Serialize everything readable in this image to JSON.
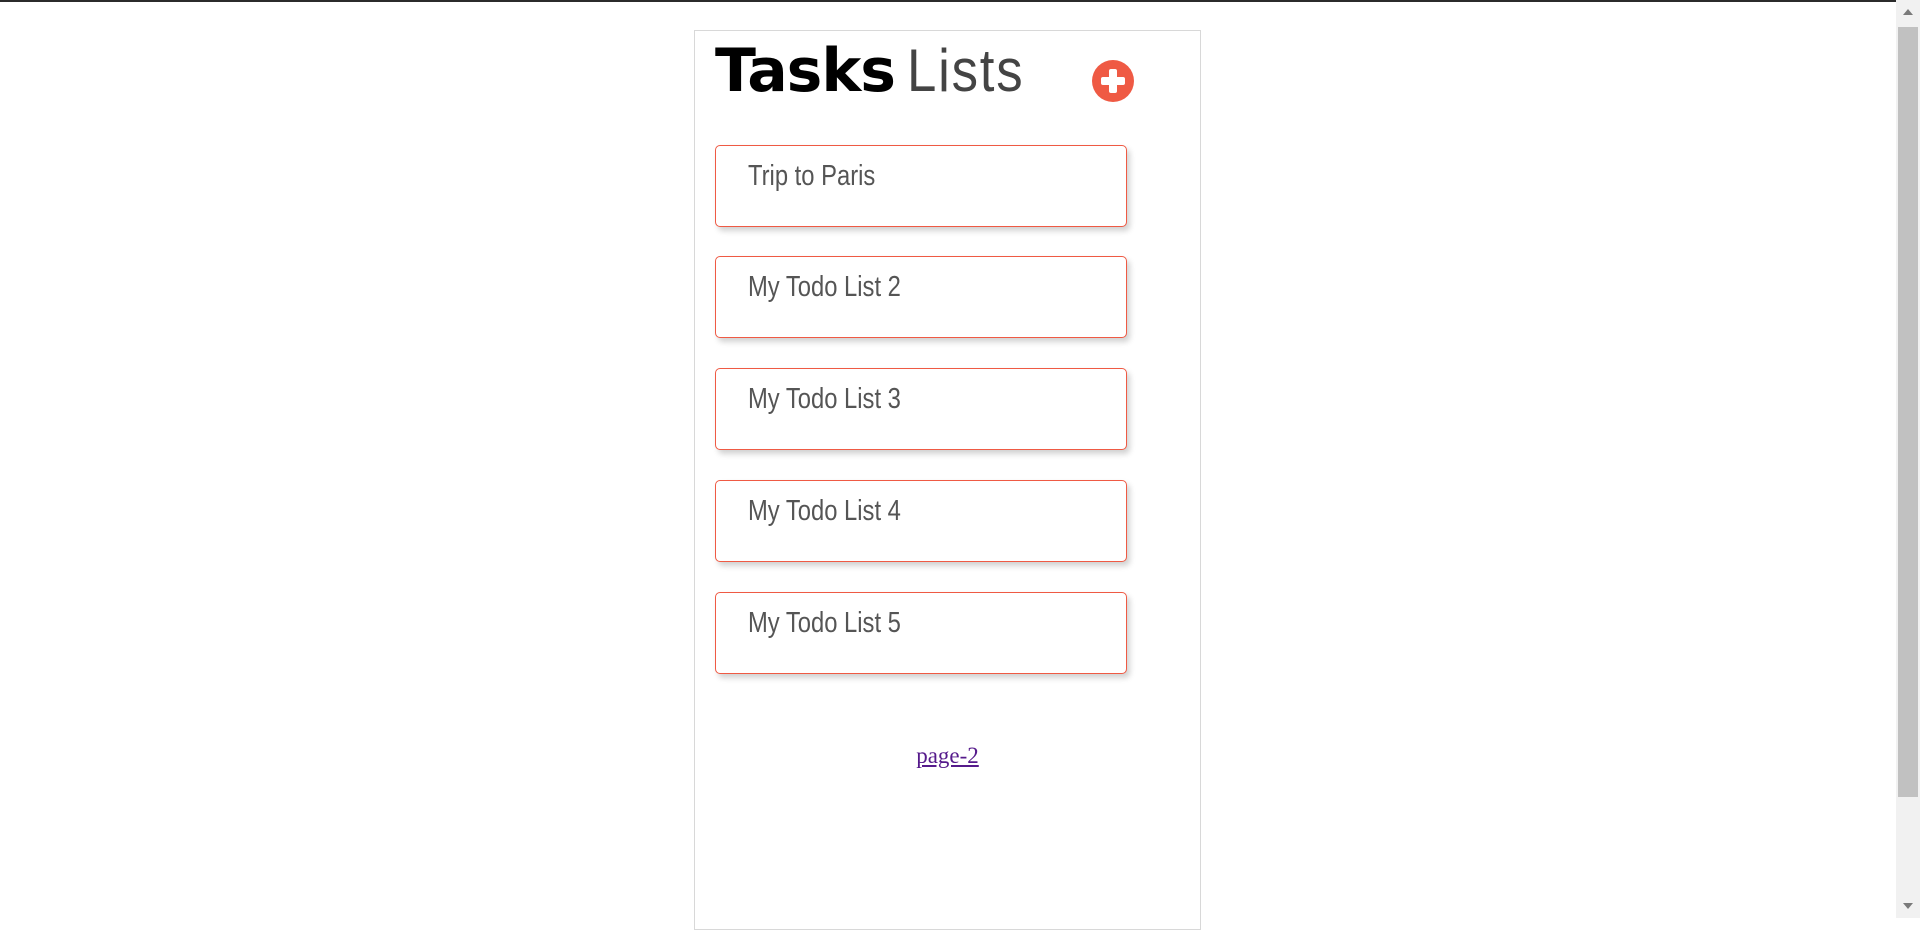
{
  "header": {
    "title_strong": "Tasks",
    "title_light": "Lists",
    "add_icon": "plus-circle-icon"
  },
  "lists": [
    {
      "label": "Trip to Paris"
    },
    {
      "label": "My Todo List 2"
    },
    {
      "label": "My Todo List 3"
    },
    {
      "label": "My Todo List 4"
    },
    {
      "label": "My Todo List 5"
    }
  ],
  "pagination": {
    "link_label": "page-2"
  },
  "colors": {
    "accent": "#ef5a44",
    "link": "#551a8b"
  }
}
